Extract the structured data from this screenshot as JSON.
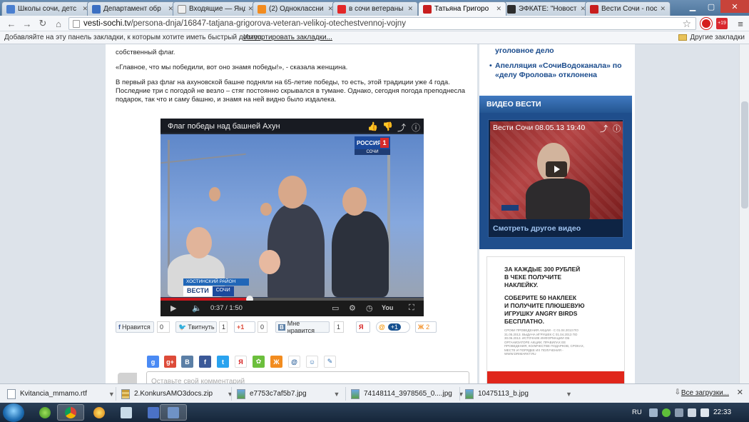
{
  "tabs": [
    {
      "label": "Школы сочи, детс",
      "fav": "#4a7fd0"
    },
    {
      "label": "Департамент обр",
      "fav": "#3b6fc2"
    },
    {
      "label": "Входящие — Янд",
      "fav": "#f0f0f0"
    },
    {
      "label": "(2) Одноклассни",
      "fav": "#f28c1f"
    },
    {
      "label": "в сочи ветераны",
      "fav": "#e32828"
    },
    {
      "label": "Татьяна Григоро",
      "fav": "#c81e1e"
    },
    {
      "label": "ЭФКАТЕ: \"Новост",
      "fav": "#2d2d2d"
    },
    {
      "label": "Вести Сочи - пос",
      "fav": "#c81e1e"
    }
  ],
  "toolbar": {
    "url_host": "vesti-sochi.tv",
    "url_path": "/persona-dnja/16847-tatjana-grigorova-veteran-velikoj-otechestvennoj-vojny",
    "ext_badge": "+19"
  },
  "bookmarks": {
    "message": "Добавляйте на эту панель закладки, к которым хотите иметь быстрый доступ.",
    "import_link": "Импортировать закладки...",
    "other": "Другие закладки"
  },
  "article": {
    "p0": "собственный флаг.",
    "p1": "«Главное, что мы победили, вот оно знамя победы!», - сказала женщина.",
    "p2a": "В первый раз флаг на ахуновской башне подняли на 65-летие победы, то есть, этой традиции уже 4 года.",
    "p2b": "Последние три с погодой не везло – стяг постоянно скрывался в тумане. Однако, сегодня погода преподнесла",
    "p2c": "подарок, так что и саму башню, и знамя на ней видно было издалека."
  },
  "video": {
    "title": "Флаг победы над башней Ахун",
    "channel": "РОССИЯ",
    "channel_num": "1",
    "channel_sub": "СОЧИ",
    "lower_top": "ХОСТИНСКИЙ РАЙОН",
    "lower_brand": "ВЕСТИ",
    "lower_city": "СОЧИ",
    "time": "0:37 / 1:50",
    "progress": 0.34
  },
  "social": {
    "fb_label": "Нравится",
    "fb_count": "0",
    "tw_label": "Твитнуть",
    "tw_count": "1",
    "gp_label": "+1",
    "gp_count": "0",
    "vk_label": "Мне нравится",
    "vk_count": "1",
    "mail_count": "+1",
    "ok_count": "2"
  },
  "share_icons": [
    "google",
    "google-plus",
    "vkontakte",
    "facebook",
    "twitter",
    "yandex",
    "moi-mir",
    "odnoklassniki",
    "mail",
    "livejournal",
    "bookmark"
  ],
  "comment": {
    "placeholder": "Оставьте свой комментарий"
  },
  "sidebar": {
    "news1": "уголовное дело",
    "news2_line1": "Апелляция «СочиВодоканала» по",
    "news2_line2": "«делу Фролова» отклонена",
    "video_head": "ВИДЕО ВЕСТИ",
    "video_title": "Вести Сочи 08.05.13 19:40",
    "video_more": "Смотреть другое видео",
    "ad_l1": "ЗА КАЖДЫЕ 300 РУБЛЕЙ",
    "ad_l2": "В ЧЕКЕ ПОЛУЧИТЕ",
    "ad_l3": "НАКЛЕЙКУ.",
    "ad_l4": "СОБЕРИТЕ 50 НАКЛЕЕК",
    "ad_l5": "И ПОЛУЧИТЕ ПЛЮШЕВУЮ",
    "ad_l6": "ИГРУШКУ ANGRY BIRDS",
    "ad_l7": "БЕСПЛАТНО.",
    "ad_small": "СРОКИ ПРОВЕДЕНИЯ АКЦИИ - С 01.04.2013 ПО 31.05.2013. ВЫДАЧА ИГРУШЕК С 01.04.2013 ПО 30.06.2013. ИСТОЧНИК ИНФОРМАЦИИ ОБ ОРГАНИЗАТОРЕ АКЦИИ, ПРАВИЛАХ ЕЕ ПРОВЕДЕНИЯ, КОЛИЧЕСТВЕ ПОДАРКОВ, СРОКАХ, МЕСТЕ И ПОРЯДКЕ ИХ ПОЛУЧЕНИЯ - WWW.DRIMARKT.RU"
  },
  "downloads": [
    {
      "name": "Kvitancia_mmamo.rtf",
      "type": "doc"
    },
    {
      "name": "2.KonkursAMO3docs.zip",
      "type": "zip"
    },
    {
      "name": "e7753c7af5b7.jpg",
      "type": "img"
    },
    {
      "name": "74148114_3978565_0....jpg",
      "type": "img"
    },
    {
      "name": "10475113_b.jpg",
      "type": "img"
    }
  ],
  "shelf": {
    "all": "Все загрузки..."
  },
  "taskbar": {
    "lang": "RU",
    "time": "22:33"
  }
}
